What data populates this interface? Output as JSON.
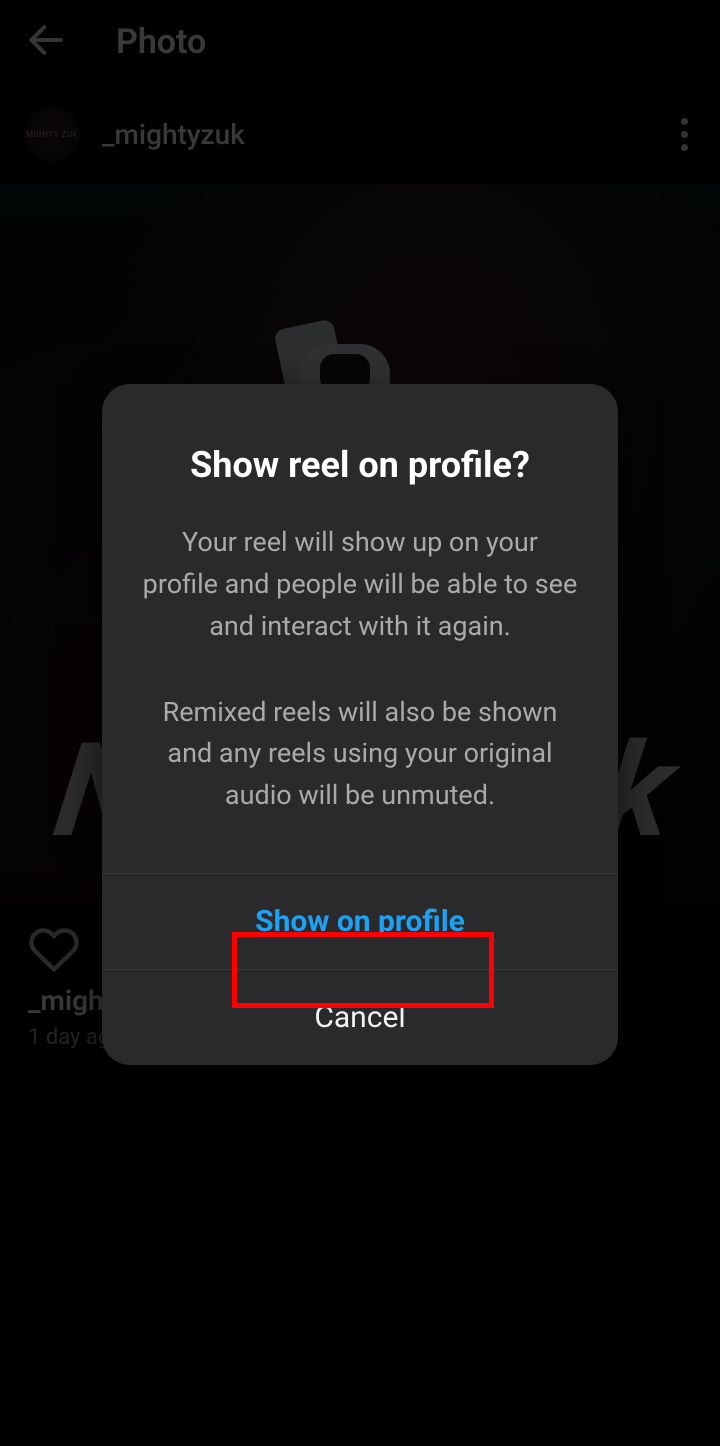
{
  "topbar": {
    "title": "Photo"
  },
  "post": {
    "username": "_mightyzuk",
    "avatar_text": "MIGHTY ZUK",
    "caption_username": "_might",
    "time": "1 day ag"
  },
  "modal": {
    "title": "Show reel on profile?",
    "body1": "Your reel will show up on your profile and people will be able to see and interact with it again.",
    "body2": "Remixed reels will also be shown and any reels using your original audio will be unmuted.",
    "primary_label": "Show on profile",
    "secondary_label": "Cancel"
  }
}
